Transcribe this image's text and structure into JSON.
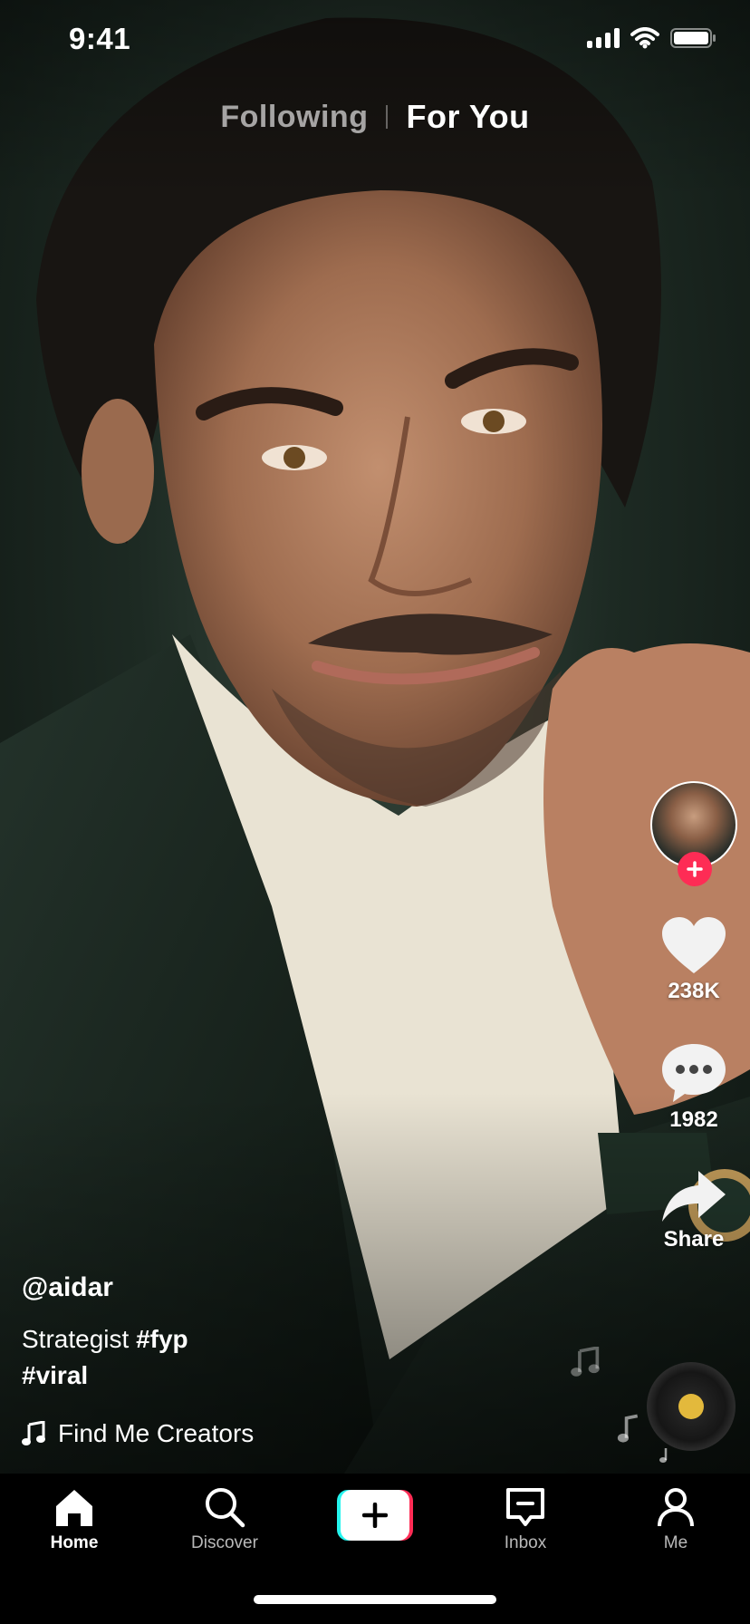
{
  "status_bar": {
    "time": "9:41"
  },
  "top_tabs": {
    "following": "Following",
    "for_you": "For You",
    "active": "For You"
  },
  "actions": {
    "likes": "238K",
    "comments": "1982",
    "share": "Share"
  },
  "post": {
    "username": "@aidar",
    "description": "Strategist",
    "hashtags": [
      "#fyp",
      "#viral"
    ],
    "music": "Find Me Creators"
  },
  "bottom_nav": {
    "items": [
      {
        "label": "Home",
        "icon": "home-icon",
        "active": true
      },
      {
        "label": "Discover",
        "icon": "search-icon",
        "active": false
      },
      {
        "label": "",
        "icon": "plus-icon",
        "active": false
      },
      {
        "label": "Inbox",
        "icon": "inbox-icon",
        "active": false
      },
      {
        "label": "Me",
        "icon": "person-icon",
        "active": false
      }
    ]
  },
  "colors": {
    "accent_red": "#fe2c55",
    "accent_cyan": "#25f4ee",
    "disc_center": "#e3b93c"
  }
}
